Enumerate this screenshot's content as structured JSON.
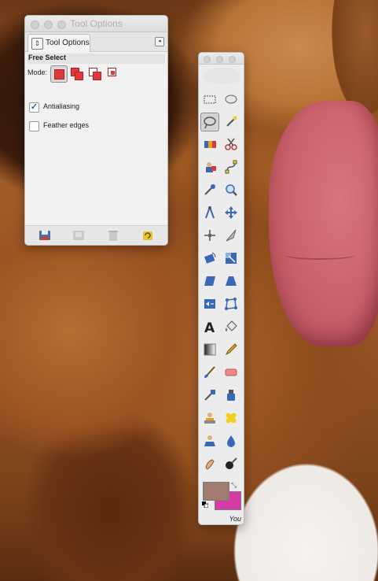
{
  "tool_options": {
    "title": "Tool Options",
    "tab_label": "Tool Options",
    "tool_name": "Free Select",
    "mode_label": "Mode:",
    "modes": [
      "replace",
      "add",
      "subtract",
      "intersect"
    ],
    "active_mode": "replace",
    "antialiasing": {
      "label": "Antialiasing",
      "checked": true
    },
    "feather_edges": {
      "label": "Feather edges",
      "checked": false
    },
    "bottom_buttons": [
      "save-options",
      "restore-options",
      "delete-options",
      "reset-options"
    ]
  },
  "toolbox": {
    "selected_tool": "free-select",
    "foreground_color": "#a17a70",
    "background_color": "#d63aa6",
    "footer_label": "You"
  },
  "colors": {
    "accent_red": "#e0383d",
    "checkbox_tick": "#2a5ea8"
  }
}
